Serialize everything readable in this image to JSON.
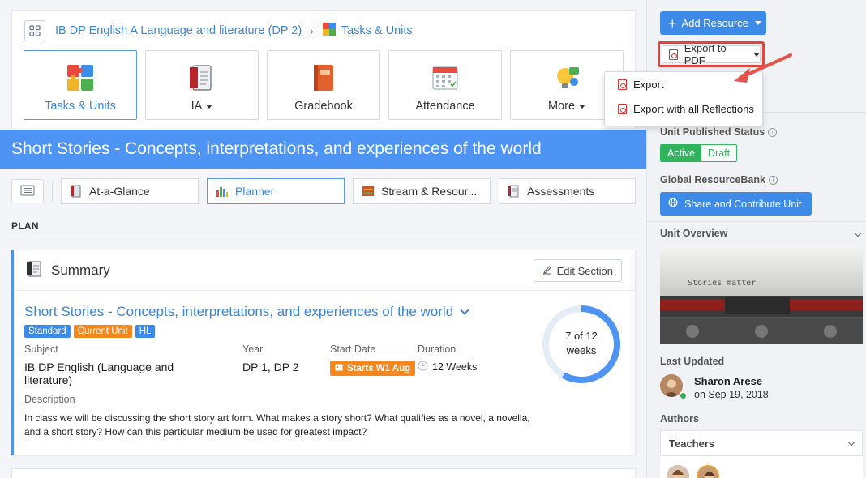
{
  "breadcrumb": {
    "course": "IB DP English A Language and literature (DP 2)",
    "current": "Tasks & Units"
  },
  "nav_tiles": [
    {
      "label": "Tasks & Units",
      "icon": "puzzle-icon",
      "active": true
    },
    {
      "label": "IA",
      "icon": "notebook-icon",
      "dropdown": true
    },
    {
      "label": "Gradebook",
      "icon": "gradebook-icon"
    },
    {
      "label": "Attendance",
      "icon": "calendar-icon"
    },
    {
      "label": "More",
      "icon": "lightbulb-icon",
      "dropdown": true
    }
  ],
  "unit_banner": "Short Stories - Concepts, interpretations, and experiences of the world",
  "subtabs": [
    {
      "label": "At-a-Glance"
    },
    {
      "label": "Planner",
      "active": true
    },
    {
      "label": "Stream & Resour..."
    },
    {
      "label": "Assessments"
    }
  ],
  "section_label": "PLAN",
  "summary": {
    "heading": "Summary",
    "edit_label": "Edit Section",
    "unit_title": "Short Stories - Concepts, interpretations, and experiences of the world",
    "badges": [
      {
        "text": "Standard",
        "color": "#3d8ae8"
      },
      {
        "text": "Current Unit",
        "color": "#f5871f"
      },
      {
        "text": "HL",
        "color": "#3d8ae8"
      }
    ],
    "subject_label": "Subject",
    "subject_line1": "IB DP English (Language and",
    "subject_line2": "literature)",
    "year_label": "Year",
    "year_value": "DP 1, DP 2",
    "start_label": "Start Date",
    "start_value": "Starts W1 Aug",
    "duration_label": "Duration",
    "duration_value": "12 Weeks",
    "description_label": "Description",
    "description": "In class we will be discussing the short story art form. What makes a story short? What qualifies as a novel, a novella, and a short story? How can this particular medium be used for greatest impact?",
    "progress": {
      "current": 7,
      "total": 12,
      "line1": "7 of 12",
      "line2": "weeks"
    }
  },
  "sidebar": {
    "add_resource": "Add Resource",
    "export_pdf": "Export to PDF",
    "export_menu": [
      "Export",
      "Export with all Reflections"
    ],
    "published_label": "Unit Published Status",
    "status_active": "Active",
    "status_draft": "Draft",
    "resourcebank_label": "Global ResourceBank",
    "share_button": "Share and Contribute Unit",
    "overview_label": "Unit Overview",
    "overview_image_text": "Stories matter",
    "updated_label": "Last Updated",
    "updated_by": "Sharon Arese",
    "updated_on": "on Sep 19, 2018",
    "authors_label": "Authors",
    "authors_tab": "Teachers"
  },
  "colors": {
    "accent": "#4d94f5",
    "primary_button": "#3d8ae8",
    "success": "#2fb35d",
    "warning": "#f5871f",
    "highlight": "#e3443f"
  }
}
